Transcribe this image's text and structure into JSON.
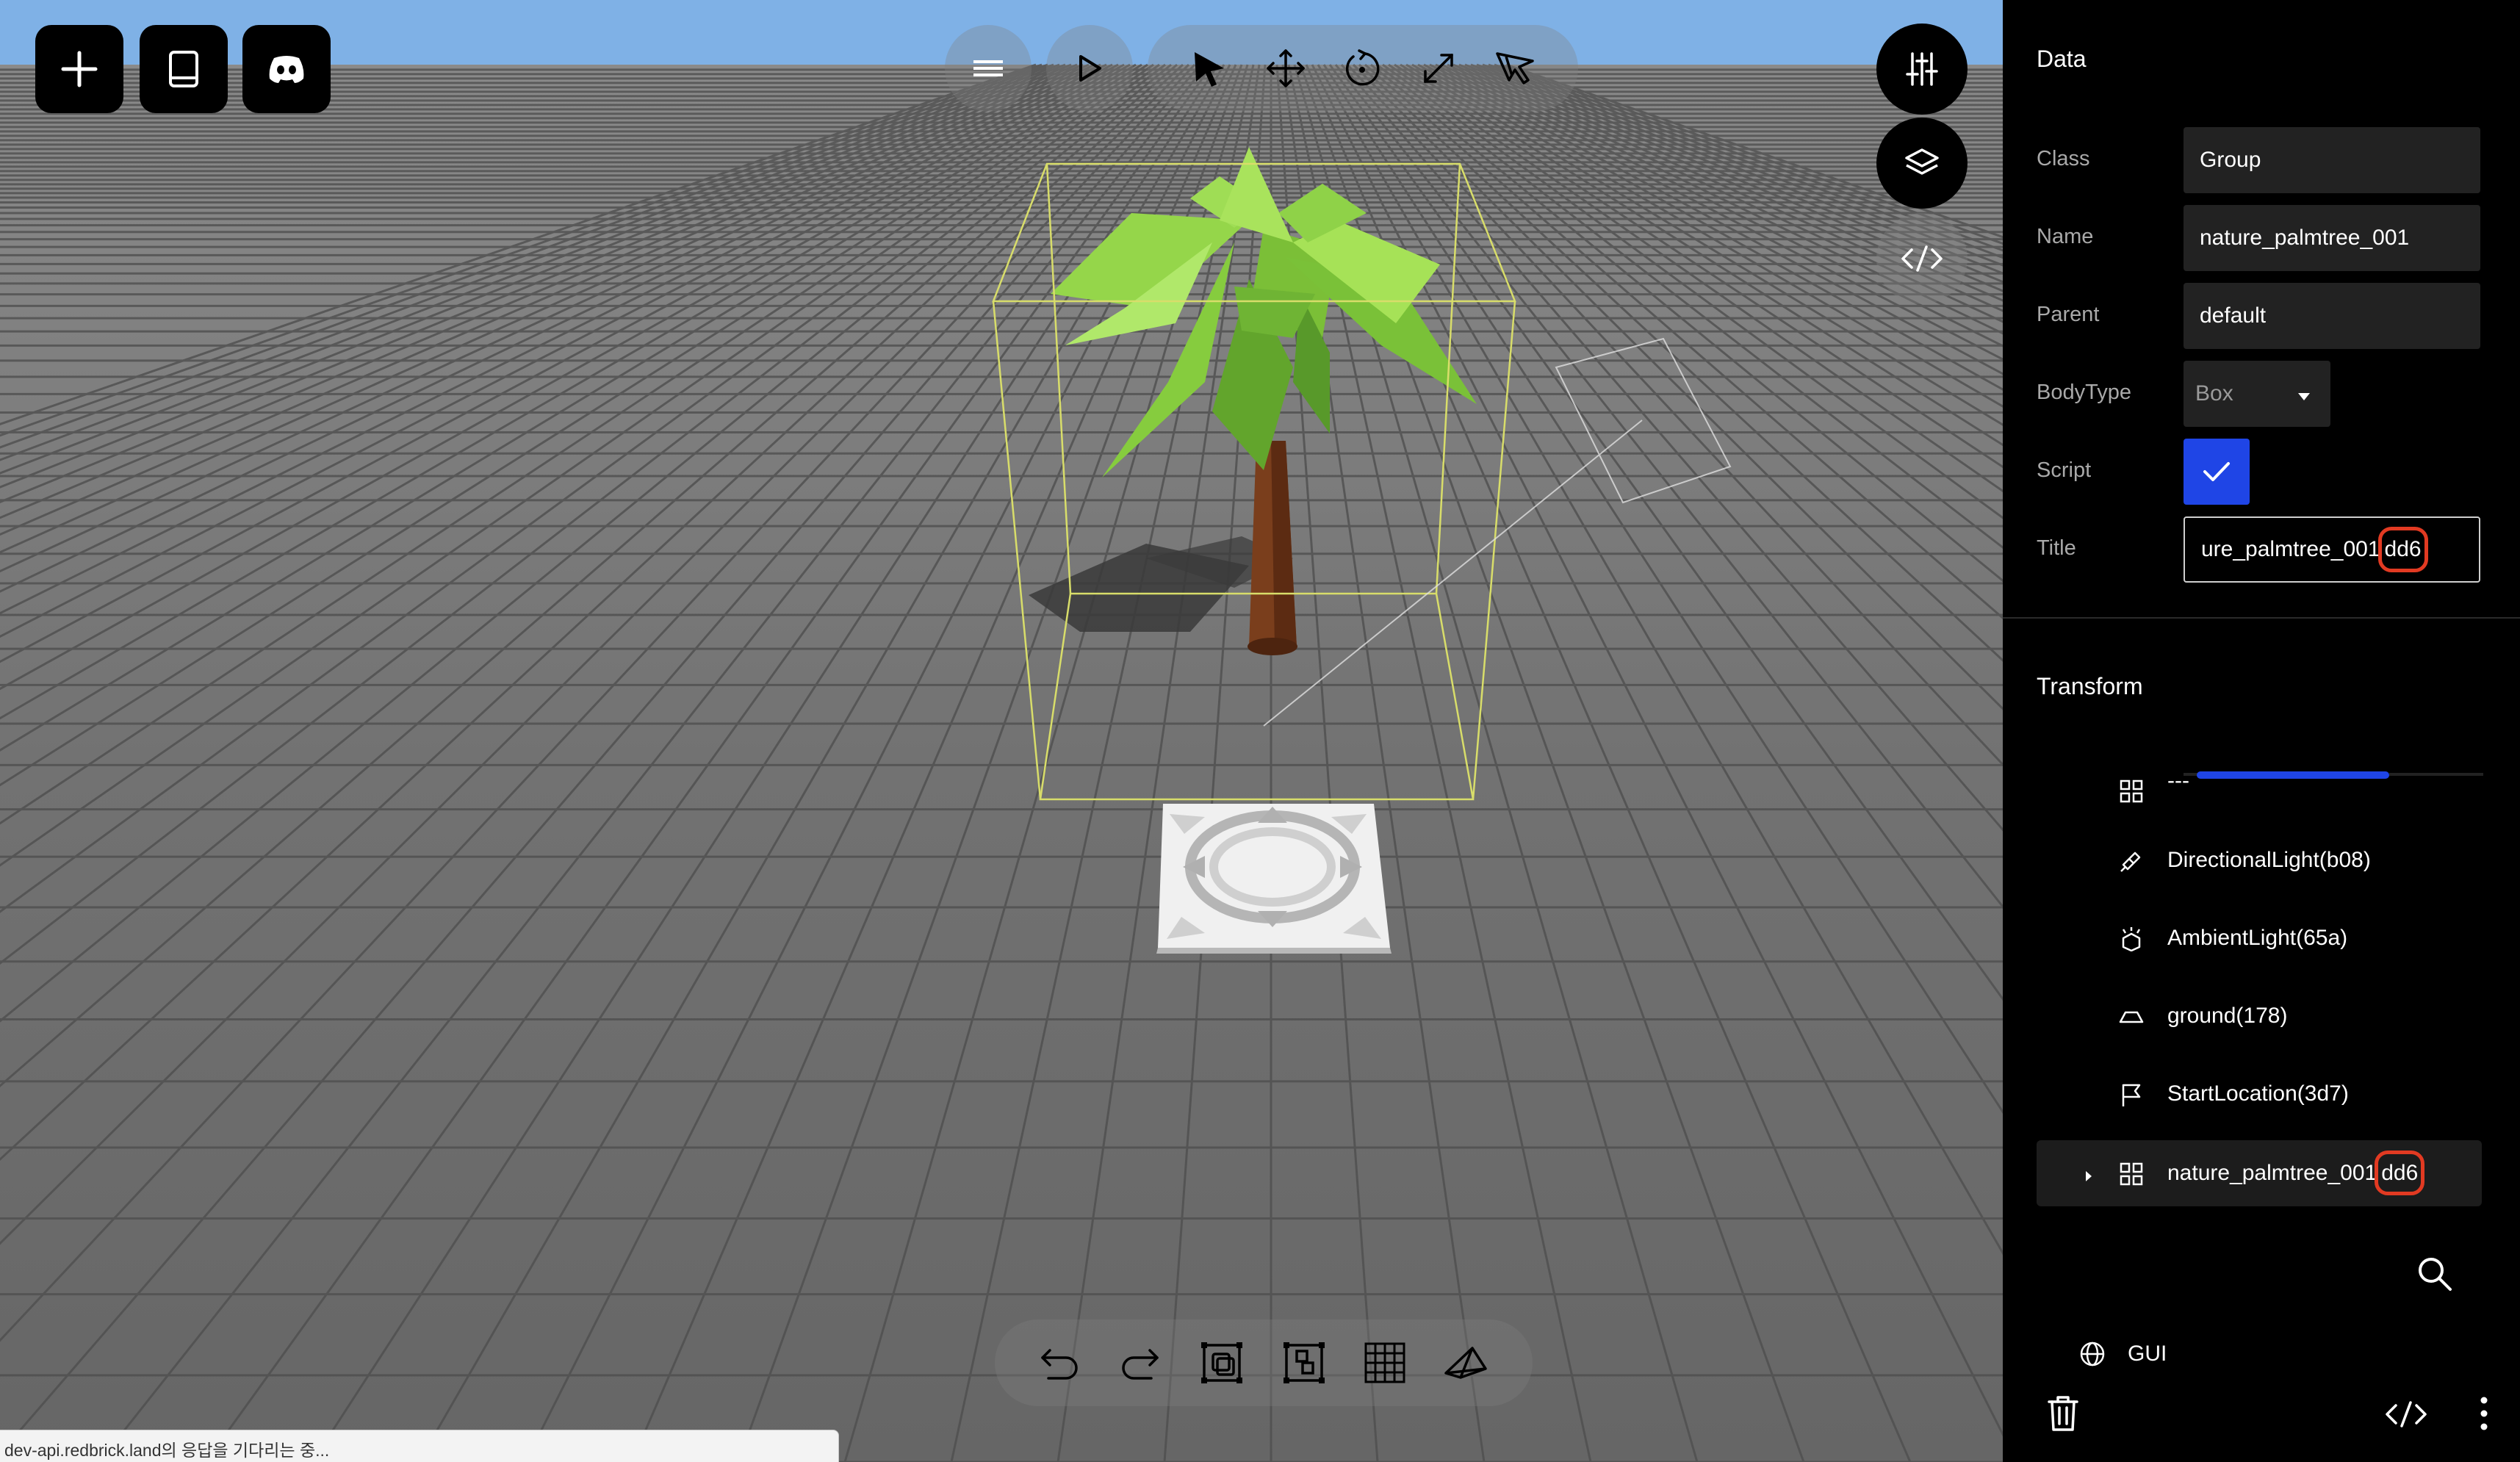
{
  "toolbar_left": [
    {
      "icon": "plus-icon"
    },
    {
      "icon": "book-icon"
    },
    {
      "icon": "discord-icon"
    }
  ],
  "toolbar_center": {
    "menu_icon": "menu-icon",
    "play_icon": "play-icon",
    "tools": [
      "select-cursor-icon",
      "move-icon",
      "rotate-icon",
      "scale-icon",
      "multi-select-icon"
    ]
  },
  "toolbar_right": [
    "settings-sliders-icon",
    "layers-icon",
    "code-icon"
  ],
  "bottom_toolbar": [
    "undo-icon",
    "redo-icon",
    "duplicate-icon",
    "group-icon",
    "grid-icon",
    "camera-icon"
  ],
  "status_bar": {
    "text": "dev-api.redbrick.land의 응답을 기다리는 중..."
  },
  "panel": {
    "data_section": {
      "title": "Data",
      "rows": [
        {
          "label": "Class",
          "value": "Group"
        },
        {
          "label": "Name",
          "value": "nature_palmtree_001"
        },
        {
          "label": "Parent",
          "value": "default"
        },
        {
          "label": "BodyType",
          "value": "Box"
        },
        {
          "label": "Script",
          "value": "checked"
        },
        {
          "label": "Title",
          "value_prefix": "ure_palmtree_001",
          "value_suffix": "dd6"
        }
      ]
    },
    "transform_section": {
      "title": "Transform"
    },
    "hierarchy": {
      "items": [
        {
          "label": "---",
          "icon": "group-grid-icon"
        },
        {
          "label": "DirectionalLight(b08)",
          "icon": "directional-light-icon"
        },
        {
          "label": "AmbientLight(65a)",
          "icon": "ambient-light-icon"
        },
        {
          "label": "ground(178)",
          "icon": "ground-plane-icon"
        },
        {
          "label": "StartLocation(3d7)",
          "icon": "flag-icon"
        },
        {
          "label_prefix": "nature_palmtree_001",
          "label_suffix": "dd6",
          "icon": "group-grid-icon",
          "selected": true
        }
      ]
    },
    "search_icon": "search-icon",
    "gui_label": "GUI",
    "bottom_icons": [
      "trash-icon",
      "code-icon",
      "more-vertical-icon"
    ]
  },
  "colors": {
    "sky": "#7fb1e6",
    "floor": "#6d6d6d",
    "panel_bg": "#000000",
    "field_bg": "#222222",
    "checkbox_blue": "#1f45e6",
    "highlight_red": "#e23a22",
    "selection_box": "#d8dd6a"
  }
}
